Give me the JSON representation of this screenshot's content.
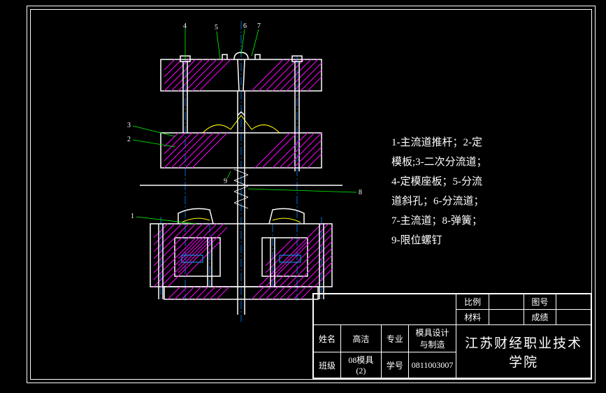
{
  "legend": {
    "line1": "1-主流道推杆；2-定",
    "line2": "模板;3-二次分流道；",
    "line3": "4-定模座板；5-分流",
    "line4": "道斜孔；6-分流道；",
    "line5": "7-主流道；8-弹簧；",
    "line6": "9-限位螺钉"
  },
  "title_block": {
    "row1": {
      "scale_label": "比例",
      "scale_val": "",
      "drawing_no_label": "图号",
      "drawing_no_val": ""
    },
    "row2": {
      "material_label": "材料",
      "material_val": "",
      "grade_label": "成绩",
      "grade_val": ""
    },
    "row3": {
      "name_label": "姓名",
      "name_val": "高洁",
      "major_label": "专业",
      "major_val": "模具设计与制造"
    },
    "row4": {
      "class_label": "班级",
      "class_val": "08模具(2)",
      "id_label": "学号",
      "id_val": "0811003007"
    },
    "school": "江苏财经职业技术学院"
  },
  "callouts": {
    "n1": "1",
    "n2": "2",
    "n3": "3",
    "n4": "4",
    "n5": "5",
    "n6": "6",
    "n7": "7",
    "n8": "8",
    "n9": "9"
  }
}
